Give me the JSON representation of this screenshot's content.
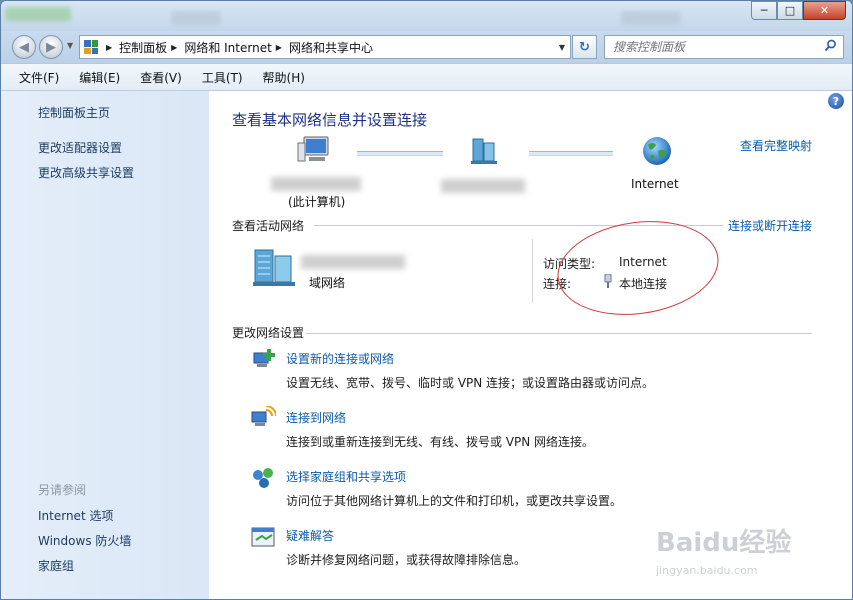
{
  "window": {
    "caption_buttons": {
      "minimize": "─",
      "maximize": "□",
      "close": "✕"
    }
  },
  "navigation": {
    "back_icon": "back-arrow-icon",
    "forward_icon": "forward-arrow-icon",
    "breadcrumbs": [
      "控制面板",
      "网络和 Internet",
      "网络和共享中心"
    ],
    "search_placeholder": "搜索控制面板"
  },
  "menubar": {
    "items": [
      "文件(F)",
      "编辑(E)",
      "查看(V)",
      "工具(T)",
      "帮助(H)"
    ]
  },
  "sidebar": {
    "links": [
      "控制面板主页",
      "更改适配器设置",
      "更改高级共享设置"
    ],
    "see_also_heading": "另请参阅",
    "see_also_links": [
      "Internet 选项",
      "Windows 防火墙",
      "家庭组"
    ]
  },
  "main": {
    "title": "查看基本网络信息并设置连接",
    "full_map_link": "查看完整映射",
    "network_map": {
      "this_computer_label": "(此计算机)",
      "internet_label": "Internet"
    },
    "active_networks": {
      "heading": "查看活动网络",
      "connect_disconnect_link": "连接或断开连接",
      "network_type": "域网络",
      "access_type_label": "访问类型:",
      "access_type_value": "Internet",
      "connections_label": "连接:",
      "connection_link": "本地连接"
    },
    "change_settings": {
      "heading": "更改网络设置",
      "tasks": [
        {
          "title": "设置新的连接或网络",
          "description": "设置无线、宽带、拨号、临时或 VPN 连接；或设置路由器或访问点。"
        },
        {
          "title": "连接到网络",
          "description": "连接到或重新连接到无线、有线、拨号或 VPN 网络连接。"
        },
        {
          "title": "选择家庭组和共享选项",
          "description": "访问位于其他网络计算机上的文件和打印机，或更改共享设置。"
        },
        {
          "title": "疑难解答",
          "description": "诊断并修复网络问题，或获得故障排除信息。"
        }
      ]
    }
  },
  "watermark": {
    "logo_text": "Baidu经验",
    "url_text": "jingyan.baidu.com"
  },
  "colors": {
    "link": "#0b5bad",
    "title": "#1e3287",
    "annotation": "#d0393c",
    "sidebar": "#dce8f6"
  }
}
